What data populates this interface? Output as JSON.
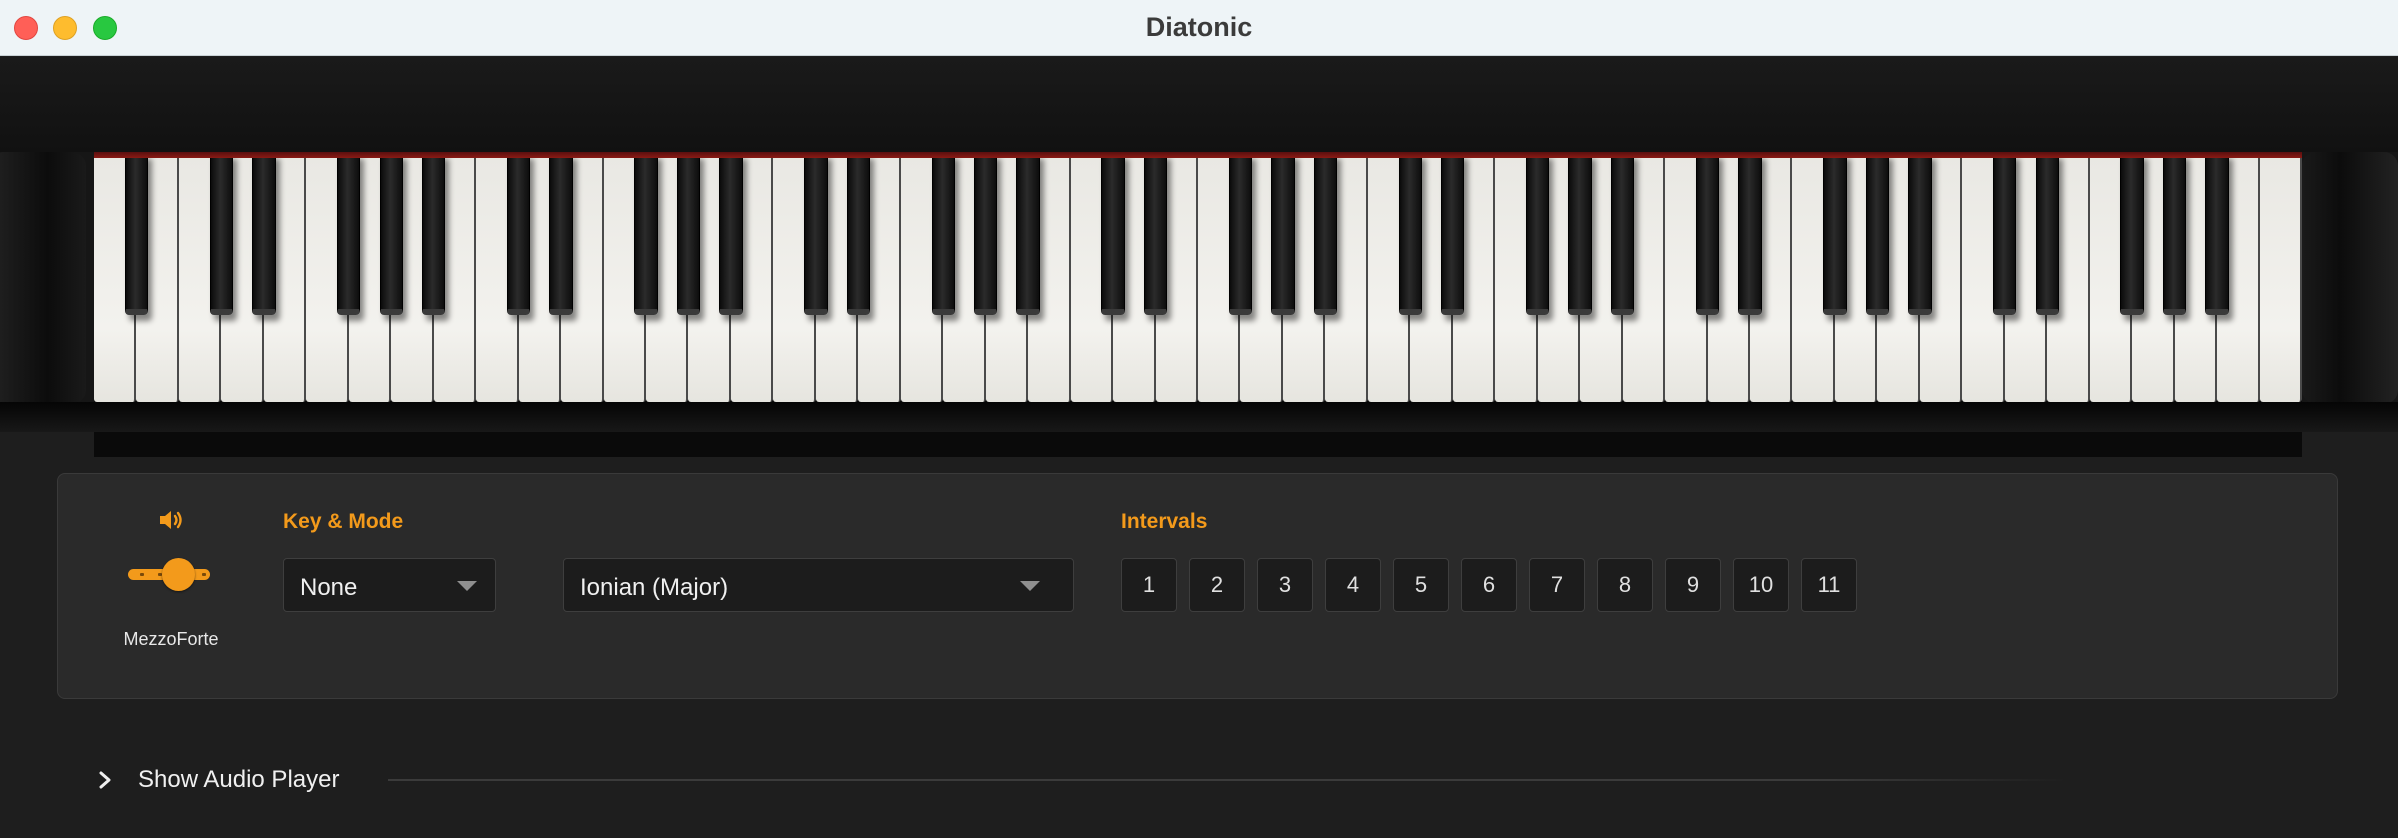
{
  "window": {
    "title": "Diatonic"
  },
  "dynamics": {
    "label": "MezzoForte",
    "level": 0.5,
    "icon": "speaker-volume-icon"
  },
  "key_mode": {
    "heading": "Key & Mode",
    "key_value": "None",
    "mode_value": "Ionian (Major)"
  },
  "intervals": {
    "heading": "Intervals",
    "buttons": [
      "1",
      "2",
      "3",
      "4",
      "5",
      "6",
      "7",
      "8",
      "9",
      "10",
      "11"
    ]
  },
  "audio_player": {
    "label": "Show Audio Player",
    "expanded": false
  },
  "colors": {
    "accent": "#f39a1b",
    "panel": "#2a2a2a",
    "background": "#1e1e1e"
  },
  "keyboard": {
    "white_keys": 52,
    "black_keys": 36,
    "first_key": "A0"
  }
}
